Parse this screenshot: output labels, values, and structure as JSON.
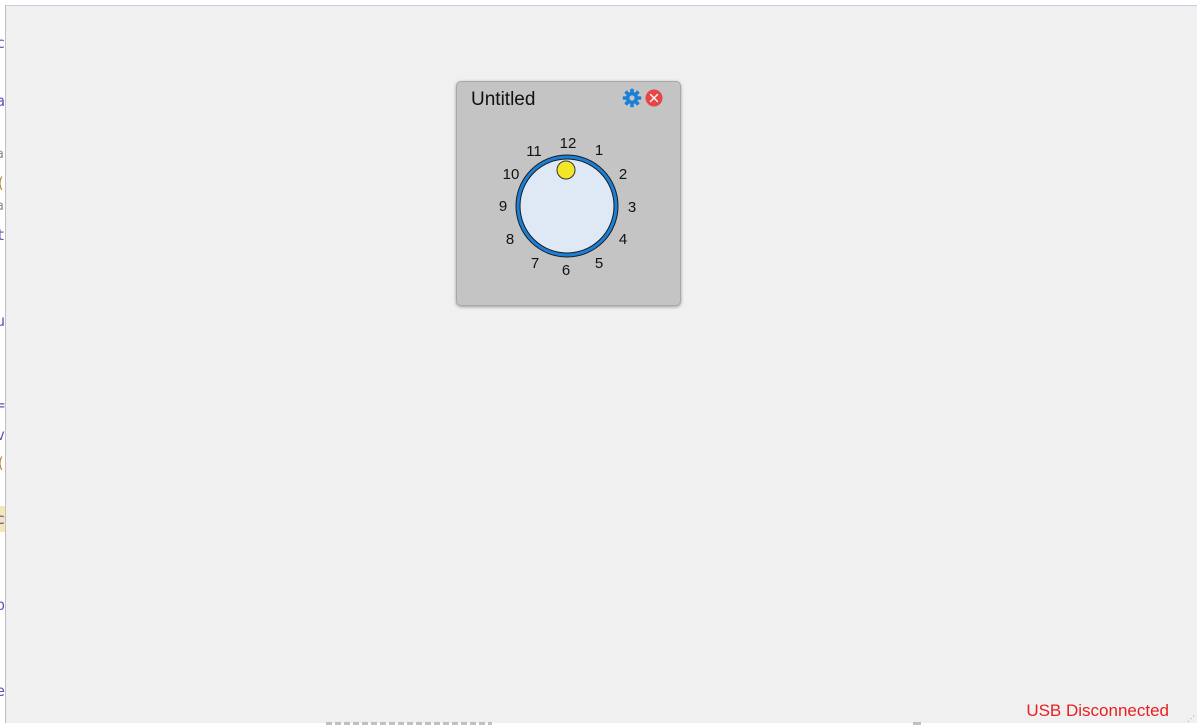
{
  "widget": {
    "title": "Untitled",
    "settings_icon": "gear-icon",
    "close_icon": "close-icon",
    "dial": {
      "numbers": [
        "12",
        "1",
        "2",
        "3",
        "4",
        "5",
        "6",
        "7",
        "8",
        "9",
        "10",
        "11"
      ],
      "selected_position": "12",
      "ring_color": "#1a7fd6",
      "face_color": "#dfe9f5",
      "indicator_color": "#f2e52a"
    }
  },
  "status": {
    "text": "USB Disconnected",
    "color": "#e81f1f"
  },
  "colors": {
    "background": "#f0f0f0",
    "widget_background": "#c4c4c4",
    "gear_icon": "#1a7fd6",
    "close_icon": "#e84545"
  }
}
